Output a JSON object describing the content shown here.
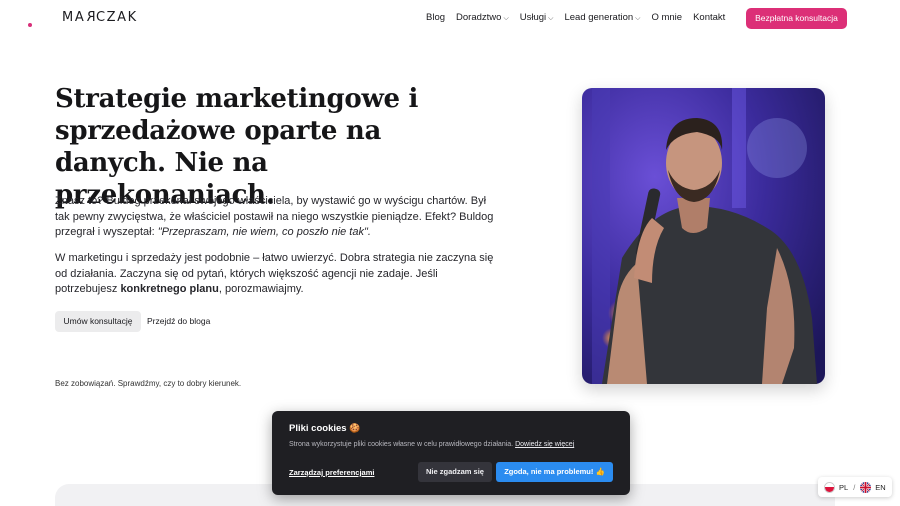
{
  "header": {
    "logo": {
      "left": "MA",
      "r": "R",
      "right": "CZAK"
    },
    "nav": [
      {
        "label": "Blog",
        "has_dropdown": false
      },
      {
        "label": "Doradztwo",
        "has_dropdown": true
      },
      {
        "label": "Usługi",
        "has_dropdown": true
      },
      {
        "label": "Lead generation",
        "has_dropdown": true
      },
      {
        "label": "O mnie",
        "has_dropdown": false
      },
      {
        "label": "Kontakt",
        "has_dropdown": false
      }
    ],
    "cta_label": "Bezpłatna konsultacja"
  },
  "hero": {
    "title_lines": [
      "Strategie marketingowe i",
      "sprzedażowe oparte na",
      "danych. Nie na przekonaniach."
    ],
    "p1_text": "Znasz to? Buldog przekonał swojego właściciela, by wystawić go w wyścigu chartów. Był tak pewny zwycięstwa, że właściciel postawił na niego wszystkie pieniądze. Efekt? Buldog przegrał i wyszeptał: ",
    "p1_quote": "\"Przepraszam, nie wiem, co poszło nie tak\".",
    "p2_text": "W marketingu i sprzedaży jest podobnie – łatwo uwierzyć. Dobra strategia nie zaczyna się od działania. Zaczyna się od pytań, których większość agencji nie zadaje. Jeśli potrzebujesz ",
    "p2_bold": "konkretnego planu",
    "p2_end": ", porozmawiajmy.",
    "btn_consult": "Umów konsultację",
    "btn_blog": "Przejdź do bloga",
    "note": "Bez zobowiązań. Sprawdźmy, czy to dobry kierunek."
  },
  "cookie": {
    "title": "Pliki cookies",
    "title_emoji": "🍪",
    "desc": "Strona wykorzystuje pliki cookies własne w celu prawidłowego działania.",
    "more": "Dowiedz się więcej",
    "manage": "Zarządzaj preferencjami",
    "reject": "Nie zgadzam się",
    "accept": "Zgoda, nie ma problemu! 👍"
  },
  "lang": {
    "pl": "PL",
    "separator": "/",
    "en": "EN"
  },
  "colors": {
    "accent": "#dc2f77",
    "cookie_bg": "#1f1f23",
    "accept_blue": "#2b8cf0"
  }
}
